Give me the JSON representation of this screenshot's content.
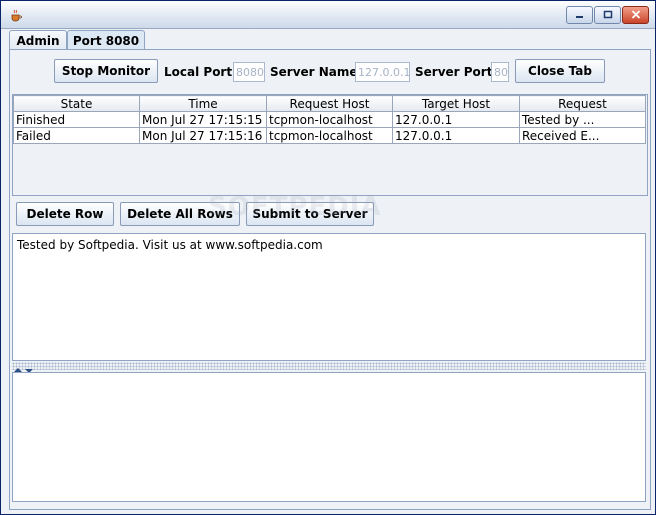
{
  "window": {
    "title": ""
  },
  "tabs": [
    {
      "label": "Admin",
      "active": false
    },
    {
      "label": "Port 8080",
      "active": true
    }
  ],
  "toolbar": {
    "stop_label": "Stop Monitor",
    "local_port_label": "Local Port:",
    "local_port_value": "8080",
    "server_name_label": "Server Name:",
    "server_name_value": "127.0.0.1",
    "server_port_label": "Server Port:",
    "server_port_value": "80",
    "close_tab_label": "Close Tab"
  },
  "table": {
    "columns": [
      "State",
      "Time",
      "Request Host",
      "Target Host",
      "Request"
    ],
    "rows": [
      [
        "Finished",
        "Mon Jul 27 17:15:15 ...",
        "tcpmon-localhost",
        "127.0.0.1",
        "Tested by ..."
      ],
      [
        "Failed",
        "Mon Jul 27 17:15:16 ...",
        "tcpmon-localhost",
        "127.0.0.1",
        "Received E..."
      ]
    ]
  },
  "actions": {
    "delete_row_label": "Delete Row",
    "delete_all_label": "Delete All Rows",
    "submit_label": "Submit to Server"
  },
  "request_text": "Tested by Softpedia. Visit us at www.softpedia.com",
  "response_text": "",
  "watermark": "SOFTPEDIA",
  "colors": {
    "accent": "#0a246a",
    "panel": "#eef2f7",
    "close": "#c9452a"
  }
}
